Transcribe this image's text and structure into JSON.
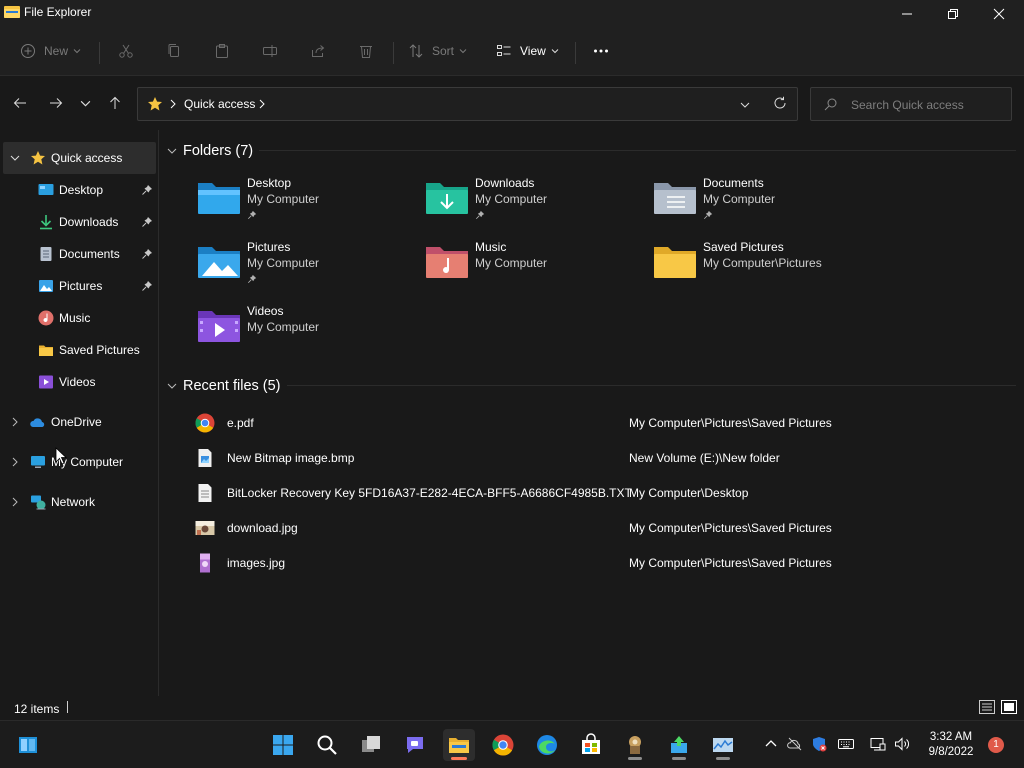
{
  "window": {
    "title": "File Explorer"
  },
  "ribbon": {
    "new_label": "New",
    "sort_label": "Sort",
    "view_label": "View"
  },
  "address": {
    "crumb": "Quick access"
  },
  "search": {
    "placeholder": "Search Quick access"
  },
  "sidebar": {
    "quick_access": "Quick access",
    "items": [
      {
        "label": "Desktop",
        "icon": "desktop-icon",
        "pinned": true
      },
      {
        "label": "Downloads",
        "icon": "downloads-icon",
        "pinned": true
      },
      {
        "label": "Documents",
        "icon": "documents-icon",
        "pinned": true
      },
      {
        "label": "Pictures",
        "icon": "pictures-icon",
        "pinned": true
      },
      {
        "label": "Music",
        "icon": "music-icon",
        "pinned": false
      },
      {
        "label": "Saved Pictures",
        "icon": "folder-icon",
        "pinned": false
      },
      {
        "label": "Videos",
        "icon": "videos-icon",
        "pinned": false
      }
    ],
    "onedrive": "OneDrive",
    "my_computer": "My Computer",
    "network": "Network"
  },
  "folders": {
    "header": "Folders (7)",
    "items": [
      {
        "name": "Desktop",
        "path": "My Computer",
        "pinned": true,
        "icon": "desktop-folder-icon"
      },
      {
        "name": "Downloads",
        "path": "My Computer",
        "pinned": true,
        "icon": "downloads-folder-icon"
      },
      {
        "name": "Documents",
        "path": "My Computer",
        "pinned": true,
        "icon": "documents-folder-icon"
      },
      {
        "name": "Pictures",
        "path": "My Computer",
        "pinned": true,
        "icon": "pictures-folder-icon"
      },
      {
        "name": "Music",
        "path": "My Computer",
        "pinned": false,
        "icon": "music-folder-icon"
      },
      {
        "name": "Saved Pictures",
        "path": "My Computer\\Pictures",
        "pinned": false,
        "icon": "folder-icon"
      },
      {
        "name": "Videos",
        "path": "My Computer",
        "pinned": false,
        "icon": "videos-folder-icon"
      }
    ]
  },
  "recent": {
    "header": "Recent files (5)",
    "items": [
      {
        "name": "e.pdf",
        "location": "My Computer\\Pictures\\Saved Pictures",
        "icon": "chrome-pdf-icon"
      },
      {
        "name": "New Bitmap image.bmp",
        "location": "New Volume (E:)\\New folder",
        "icon": "bitmap-file-icon"
      },
      {
        "name": "BitLocker Recovery Key 5FD16A37-E282-4ECA-BFF5-A6686CF4985B.TXT",
        "location": "My Computer\\Desktop",
        "icon": "text-file-icon"
      },
      {
        "name": "download.jpg",
        "location": "My Computer\\Pictures\\Saved Pictures",
        "icon": "image-thumbnail-icon"
      },
      {
        "name": "images.jpg",
        "location": "My Computer\\Pictures\\Saved Pictures",
        "icon": "image-thumbnail-icon"
      }
    ]
  },
  "status": {
    "item_count": "12 items"
  },
  "taskbar": {
    "time": "3:32 AM",
    "date": "9/8/2022",
    "notifications": "1"
  },
  "colors": {
    "background": "#191919",
    "chrome": "#202020",
    "selection": "#2d2d2d",
    "folder_yellow": "#f8c846",
    "accent_blue": "#1e90d8"
  }
}
